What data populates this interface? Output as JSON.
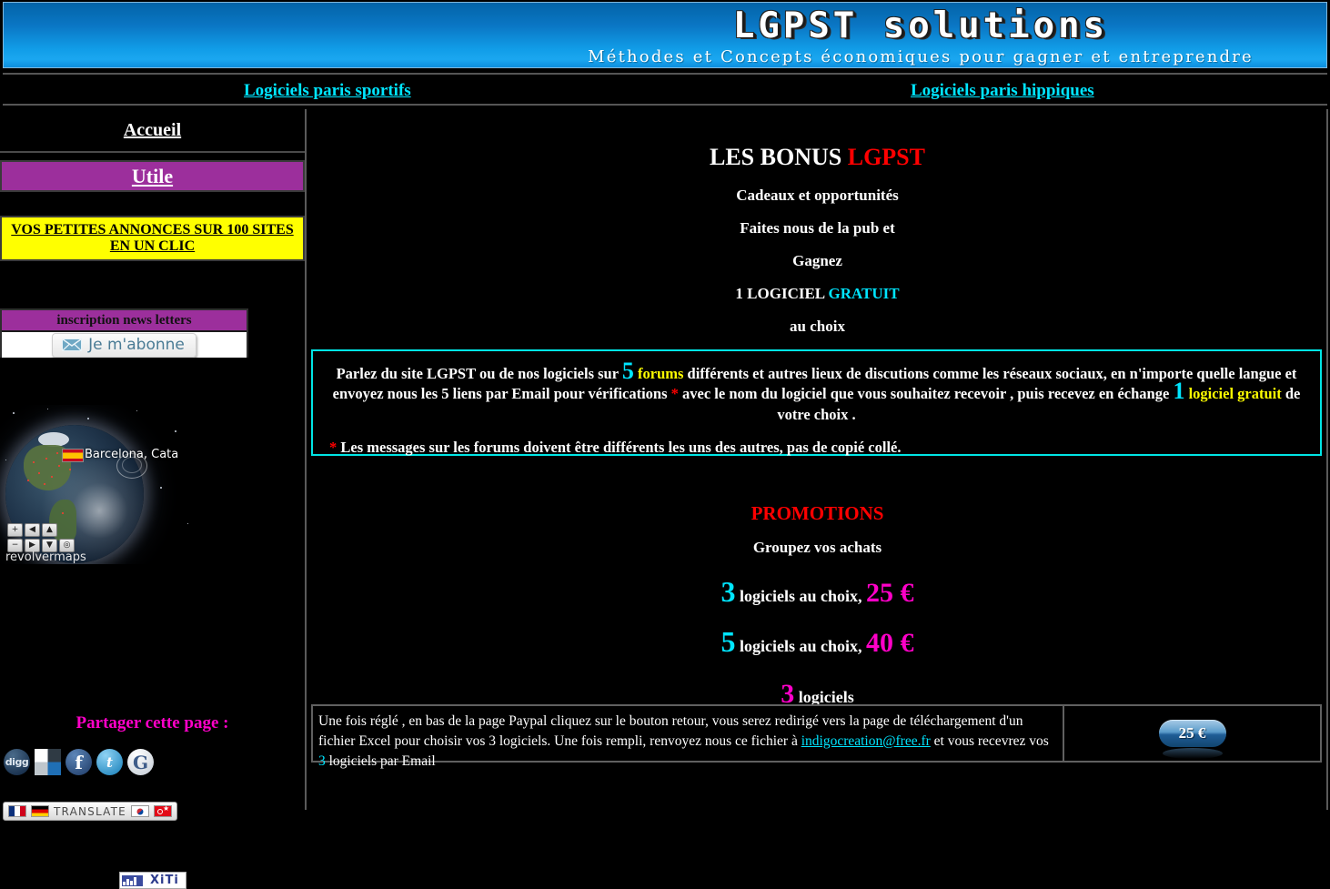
{
  "header": {
    "logo_title": "LGPST solutions",
    "logo_tagline": "Méthodes et Concepts économiques pour gagner et entreprendre"
  },
  "topnav": {
    "left_link": "Logiciels paris sportifs",
    "right_link": "Logiciels paris hippiques"
  },
  "sidebar": {
    "accueil": "Accueil",
    "utile": "Utile",
    "annonces": "VOS PETITES ANNONCES SUR 100 SITES EN UN CLIC",
    "newsletter": {
      "title": "inscription news letters",
      "button": "Je m'abonne",
      "icon": "envelope-icon"
    },
    "globe": {
      "location_label": "Barcelona, Cata",
      "flag": "spain-flag-icon",
      "credit": "revolvermaps",
      "controls": [
        "+",
        "◀",
        "▲",
        "−",
        "▶",
        "▼",
        "◎"
      ]
    },
    "share": {
      "title": "Partager cette page :",
      "icons": [
        {
          "name": "digg-icon",
          "label": "digg"
        },
        {
          "name": "delicious-icon",
          "label": ""
        },
        {
          "name": "facebook-icon",
          "label": "f"
        },
        {
          "name": "twitter-icon",
          "label": "t"
        },
        {
          "name": "google-icon",
          "label": "G"
        }
      ]
    },
    "translate": {
      "label": "TRANSLATE",
      "flags": [
        "france-flag-icon",
        "germany-flag-icon",
        "korea-flag-icon",
        "turkey-flag-icon"
      ]
    },
    "xiti": {
      "label": "XiTi"
    }
  },
  "main": {
    "title_plain": "LES BONUS ",
    "title_accent": "LGPST",
    "lines": [
      "Cadeaux et opportunités",
      "Faites nous de la pub et",
      "Gagnez"
    ],
    "logiciel_line_plain": "1 LOGICIEL ",
    "logiciel_line_accent": "GRATUIT",
    "au_choix": "au choix",
    "cyanbox": {
      "p1_a": "Parlez du site LGPST ou de nos logiciels sur ",
      "p1_num": "5",
      "p1_b": " forums",
      "p1_c": " différents et autres lieux de discutions comme les réseaux sociaux, en n'importe quelle langue et envoyez nous les 5 liens par Email pour vérifications ",
      "p1_star": "*",
      "p1_d": " avec le nom du logiciel que vous souhaitez recevoir , puis recevez en échange ",
      "p1_num2": "1",
      "p1_e": " logiciel gratuit",
      "p1_f": " de votre choix .",
      "p2_star": "*",
      "p2": " Les messages sur les forums doivent être différents les uns des autres, pas de copié collé."
    },
    "promotions_title": "PROMOTIONS",
    "groupez": "Groupez vos achats",
    "prices": [
      {
        "qty": "3",
        "text": " logiciels au choix, ",
        "value": "25 €"
      },
      {
        "qty": "5",
        "text": " logiciels au choix, ",
        "value": "40 €"
      }
    ],
    "third_line_qty": "3",
    "third_line_text": " logiciels",
    "bottom": {
      "text_a": "Une fois réglé , en bas de la page Paypal cliquez sur le bouton retour, vous serez redirigé vers la page de téléchargement d'un fichier Excel pour choisir vos 3 logiciels. Une fois rempli, renvoyez nous ce fichier à ",
      "email": "indigocreation@free.fr",
      "text_b": " et vous recevrez vos ",
      "count": "3",
      "text_c": " logiciels par Email",
      "paypal_button": "25 €"
    }
  },
  "colors": {
    "accent_cyan": "#00e5ff",
    "accent_magenta": "#ff00c8",
    "accent_red": "#ff0000",
    "accent_yellow": "#ffff00",
    "purple": "#9c2f9c",
    "banner_blue": "#119de8"
  }
}
